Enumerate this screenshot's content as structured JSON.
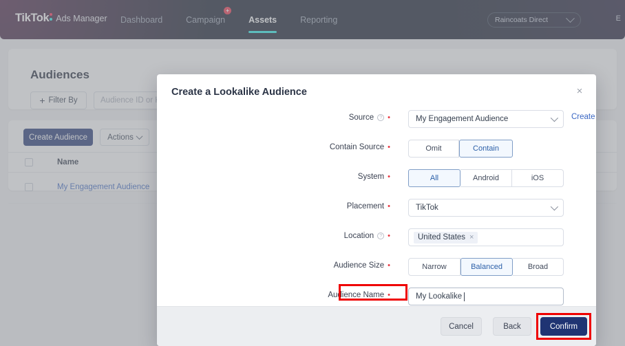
{
  "navbar": {
    "brand_main": "TikTok",
    "brand_sub": "Ads Manager",
    "links": [
      {
        "label": "Dashboard",
        "active": false,
        "badge": ""
      },
      {
        "label": "Campaign",
        "active": false,
        "badge": "+"
      },
      {
        "label": "Assets",
        "active": true,
        "badge": ""
      },
      {
        "label": "Reporting",
        "active": false,
        "badge": ""
      }
    ],
    "account_name": "Raincoats Direct",
    "right_text": "E"
  },
  "page": {
    "title": "Audiences",
    "filter_label": "Filter By",
    "search_placeholder": "Audience ID or Keyword",
    "create_audience_label": "Create Audience",
    "actions_label": "Actions",
    "table": {
      "columns": [
        "Name"
      ],
      "rows": [
        {
          "name": "My Engagement Audience"
        }
      ]
    }
  },
  "modal": {
    "title": "Create a Lookalike Audience",
    "close_icon": "×",
    "side_link": "Create a Custom Audience",
    "fields": {
      "source": {
        "label": "Source",
        "required": "•",
        "has_help": true,
        "value": "My Engagement Audience"
      },
      "contain_source": {
        "label": "Contain Source",
        "required": "•",
        "has_help": false,
        "options": [
          "Omit",
          "Contain"
        ],
        "selected": "Contain"
      },
      "system": {
        "label": "System",
        "required": "•",
        "has_help": false,
        "options": [
          "All",
          "Android",
          "iOS"
        ],
        "selected": "All"
      },
      "placement": {
        "label": "Placement",
        "required": "•",
        "has_help": false,
        "value": "TikTok"
      },
      "location": {
        "label": "Location",
        "required": "•",
        "has_help": true,
        "tag": "United States",
        "tag_remove_icon": "×"
      },
      "audience_size": {
        "label": "Audience Size",
        "required": "•",
        "has_help": false,
        "options": [
          "Narrow",
          "Balanced",
          "Broad"
        ],
        "selected": "Balanced"
      },
      "audience_name": {
        "label": "Audience Name",
        "required": "•",
        "has_help": false,
        "value": "My Lookalike ",
        "highlighted": true
      }
    },
    "footer": {
      "cancel_label": "Cancel",
      "back_label": "Back",
      "confirm_label": "Confirm",
      "confirm_highlighted": true
    }
  },
  "colors": {
    "navbar_bg": "#101828",
    "accent_cyan": "#25f4ee",
    "accent_pink": "#fe2c55",
    "primary_blue": "#1f3473",
    "link_blue": "#3a67c4",
    "required_red": "#e8343f",
    "highlight_red": "#ef0000",
    "segment_selected_bg": "#f3f8fe",
    "segment_selected_border": "#7f9dc6"
  }
}
